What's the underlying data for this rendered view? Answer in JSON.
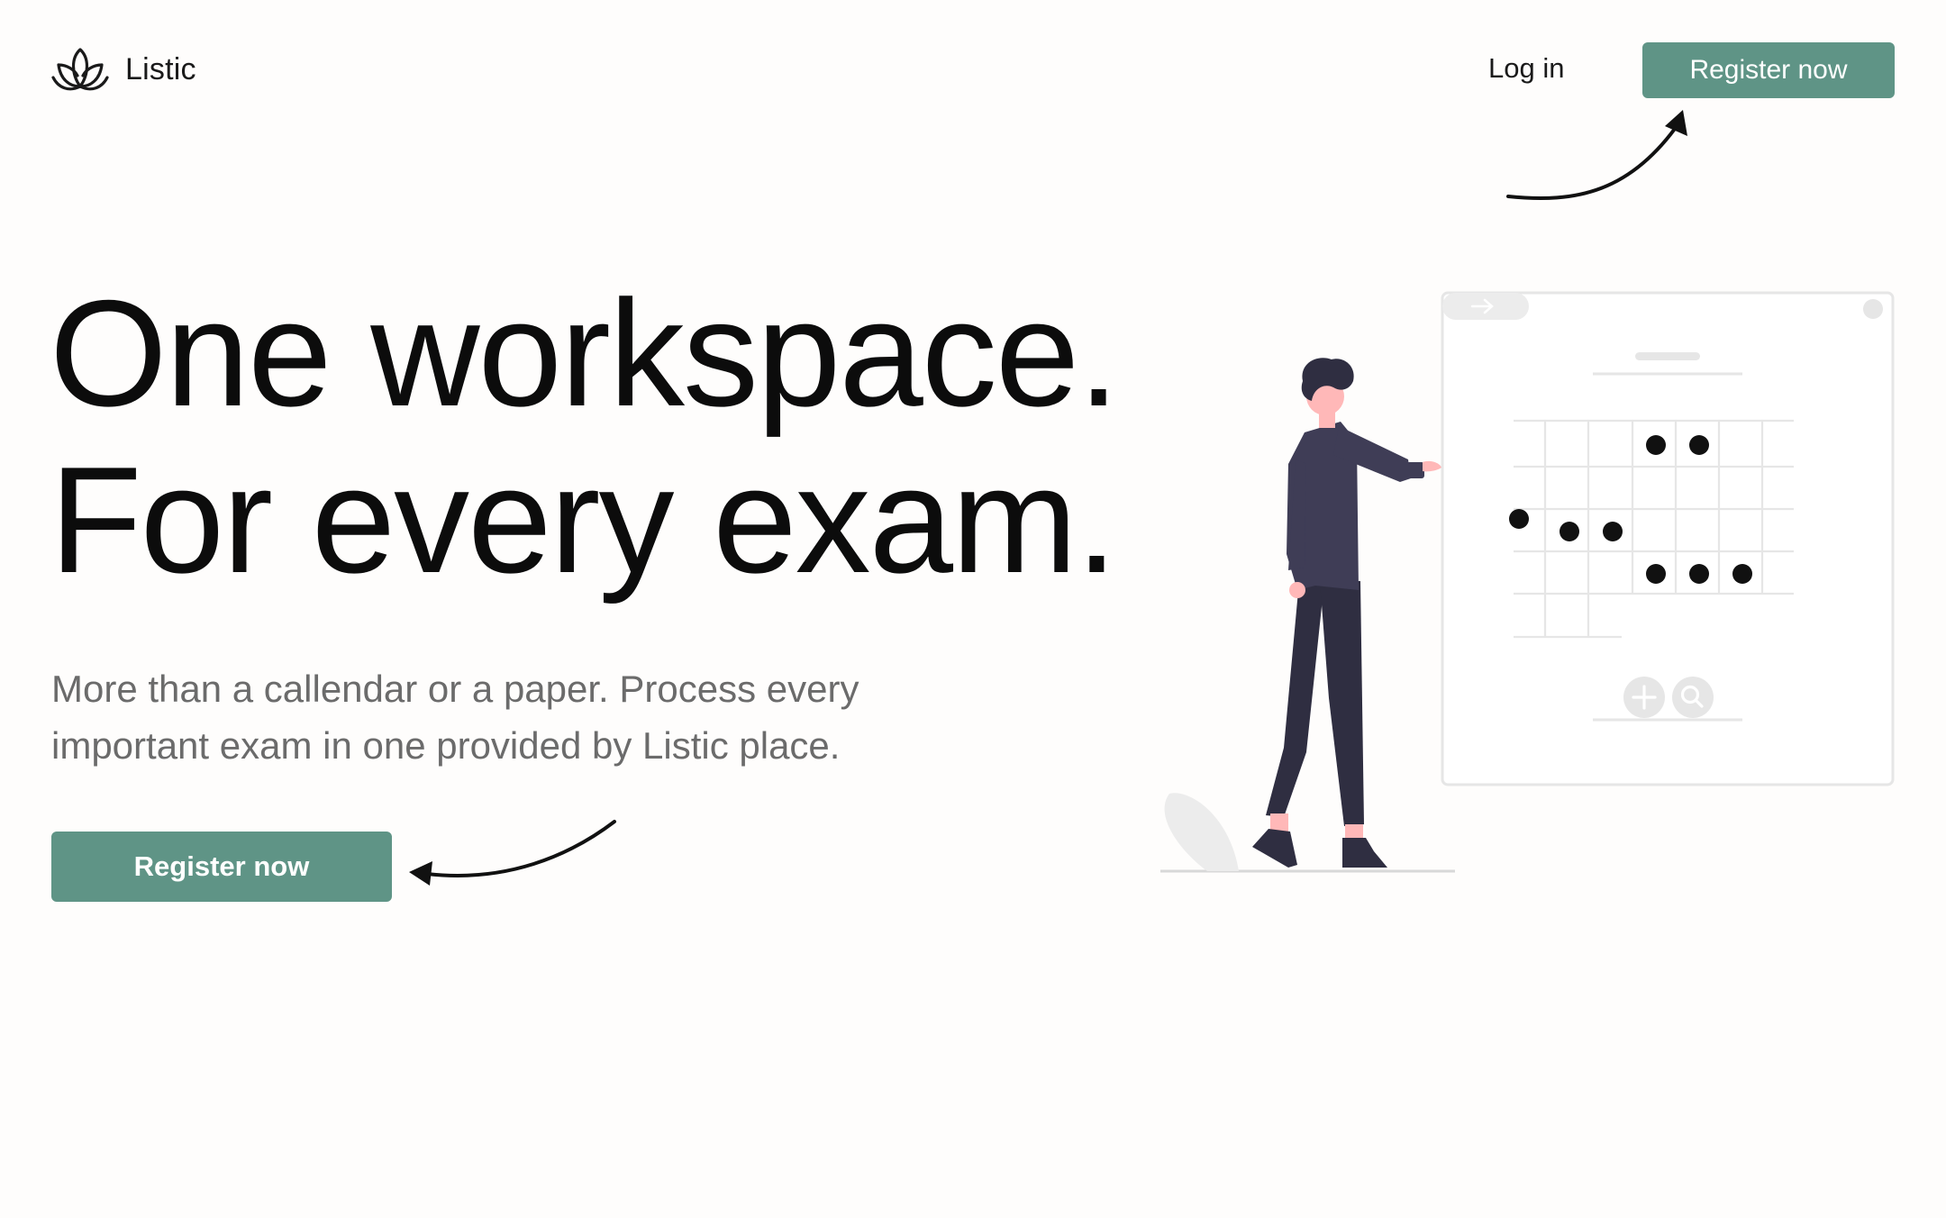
{
  "header": {
    "brand_name": "Listic",
    "logo_icon": "lotus-icon",
    "login_label": "Log in",
    "register_label": "Register now"
  },
  "hero": {
    "title_line1": "One workspace.",
    "title_line2": "For every exam.",
    "subtitle": "More than a callendar or a paper. Process every important exam in one provided by Listic place.",
    "cta_label": "Register now"
  },
  "illustration": {
    "name": "person-with-calendar-board",
    "icons": [
      "arrow-right-icon",
      "plus-icon",
      "search-icon"
    ]
  },
  "colors": {
    "accent": "#5f9486",
    "background": "#fefdfc",
    "text": "#0c0c0c",
    "muted_text": "#6b6b6b",
    "figure_dark": "#3f3d56",
    "figure_pants": "#2f2e41",
    "skin": "#ffb8b8"
  }
}
